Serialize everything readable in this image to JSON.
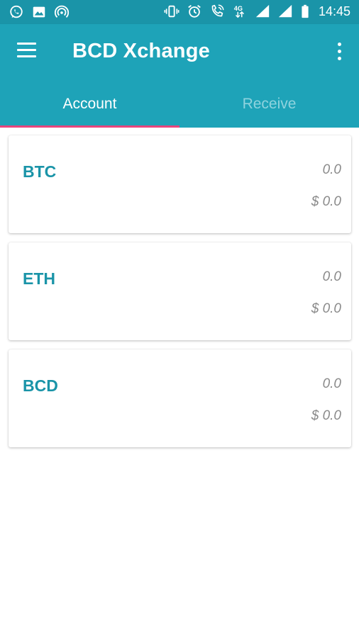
{
  "status_bar": {
    "time": "14:45",
    "left_icons": [
      "whatsapp-icon",
      "image-icon",
      "hotspot-icon"
    ],
    "right_icons": [
      "vibrate-icon",
      "alarm-icon",
      "wifi-call-icon",
      "4g-icon",
      "signal-icon",
      "signal-icon",
      "battery-icon"
    ],
    "network_label": "4G"
  },
  "app_bar": {
    "title": "BCD Xchange"
  },
  "tabs": [
    {
      "label": "Account",
      "selected": true
    },
    {
      "label": "Receive",
      "selected": false
    }
  ],
  "accounts": [
    {
      "symbol": "BTC",
      "amount": "0.0",
      "fiat": "$ 0.0"
    },
    {
      "symbol": "ETH",
      "amount": "0.0",
      "fiat": "$ 0.0"
    },
    {
      "symbol": "BCD",
      "amount": "0.0",
      "fiat": "$ 0.0"
    }
  ],
  "colors": {
    "status_bar": "#1a94a8",
    "app_bar": "#1ea3b8",
    "tab_indicator": "#e8457c",
    "symbol_text": "#1a94a8",
    "value_text": "#8a8a8a"
  }
}
